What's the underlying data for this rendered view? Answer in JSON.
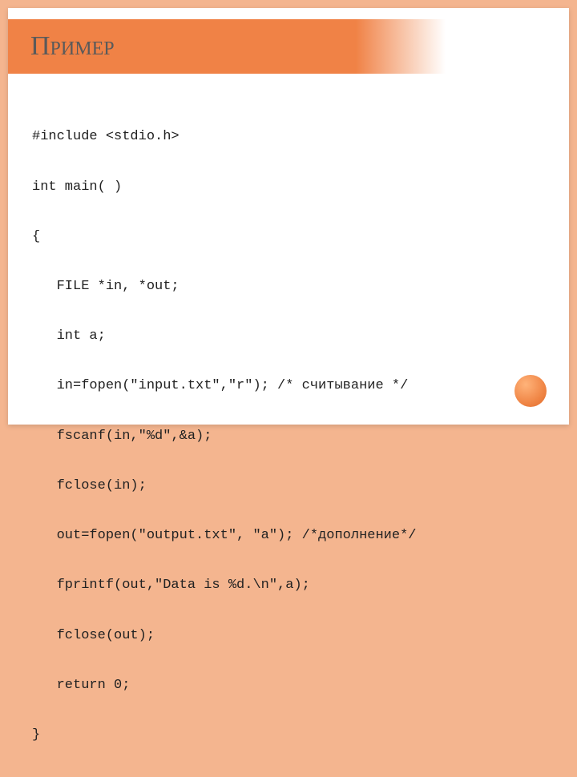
{
  "title": "Пример",
  "code_lines": [
    "#include <stdio.h>",
    "int main( )",
    "{",
    "   FILE *in, *out;",
    "   int a;",
    "   in=fopen(\"input.txt\",\"r\"); /* считывание */",
    "   fscanf(in,\"%d\",&a);",
    "   fclose(in);",
    "   out=fopen(\"output.txt\", \"a\"); /*дополнение*/",
    "   fprintf(out,\"Data is %d.\\n\",a);",
    "   fclose(out);",
    "   return 0;",
    "}"
  ]
}
